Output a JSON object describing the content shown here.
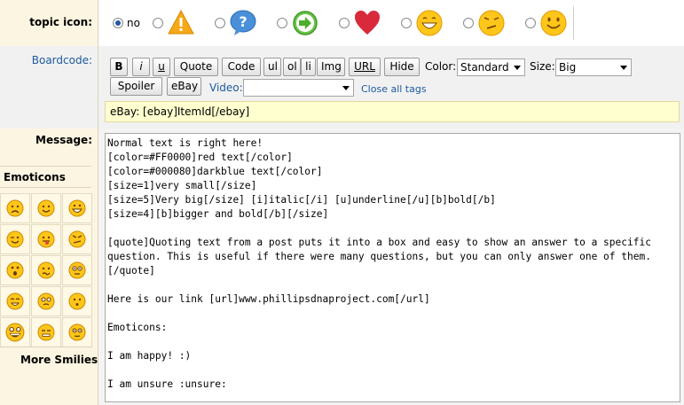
{
  "topic_icon": {
    "label": "topic icon:",
    "no_label": "no",
    "icons": [
      "warning-icon",
      "question-bubble-icon",
      "arrow-right-icon",
      "heart-icon",
      "laughing-smiley-icon",
      "annoyed-smiley-icon",
      "smiley-icon"
    ]
  },
  "boardcode": {
    "label": "Boardcode:",
    "buttons": {
      "bold": "B",
      "italic": "i",
      "underline": "u",
      "quote": "Quote",
      "code": "Code",
      "ul": "ul",
      "ol": "ol",
      "li": "li",
      "img": "Img",
      "url": "URL",
      "hide": "Hide",
      "spoiler": "Spoiler",
      "ebay": "eBay"
    },
    "color_label": "Color:",
    "color_value": "Standard",
    "size_label": "Size:",
    "size_value": "Big",
    "video_label": "Video:",
    "video_value": "",
    "close_all": "Close all tags",
    "help_text": "eBay: [ebay]ItemId[/ebay]"
  },
  "message": {
    "label": "Message:",
    "emoticons_title": "Emoticons",
    "more_smilies": "More Smilies",
    "text": "Normal text is right here!\n[color=#FF0000]red text[/color]\n[color=#000080]darkblue text[/color]\n[size=1]very small[/size]\n[size=5]Very big[/size] [i]italic[/i] [u]underline[/u][b]bold[/b]\n[size=4][b]bigger and bold[/b][/size]\n\n[quote]Quoting text from a post puts it into a box and easy to show an answer to a specific question. This is useful if there were many questions, but you can only answer one of them.\n[/quote]\n\nHere is our link [url]www.phillipsdnaproject.com[/url]\n\nEmoticons:\n\nI am happy! :)\n\nI am unsure :unsure:"
  },
  "colors": {
    "left_bg": "#fbf5e1",
    "link_blue": "#1e5aa0",
    "help_bg": "#ffffcf",
    "smiley_yellow": "#ffc61a"
  }
}
